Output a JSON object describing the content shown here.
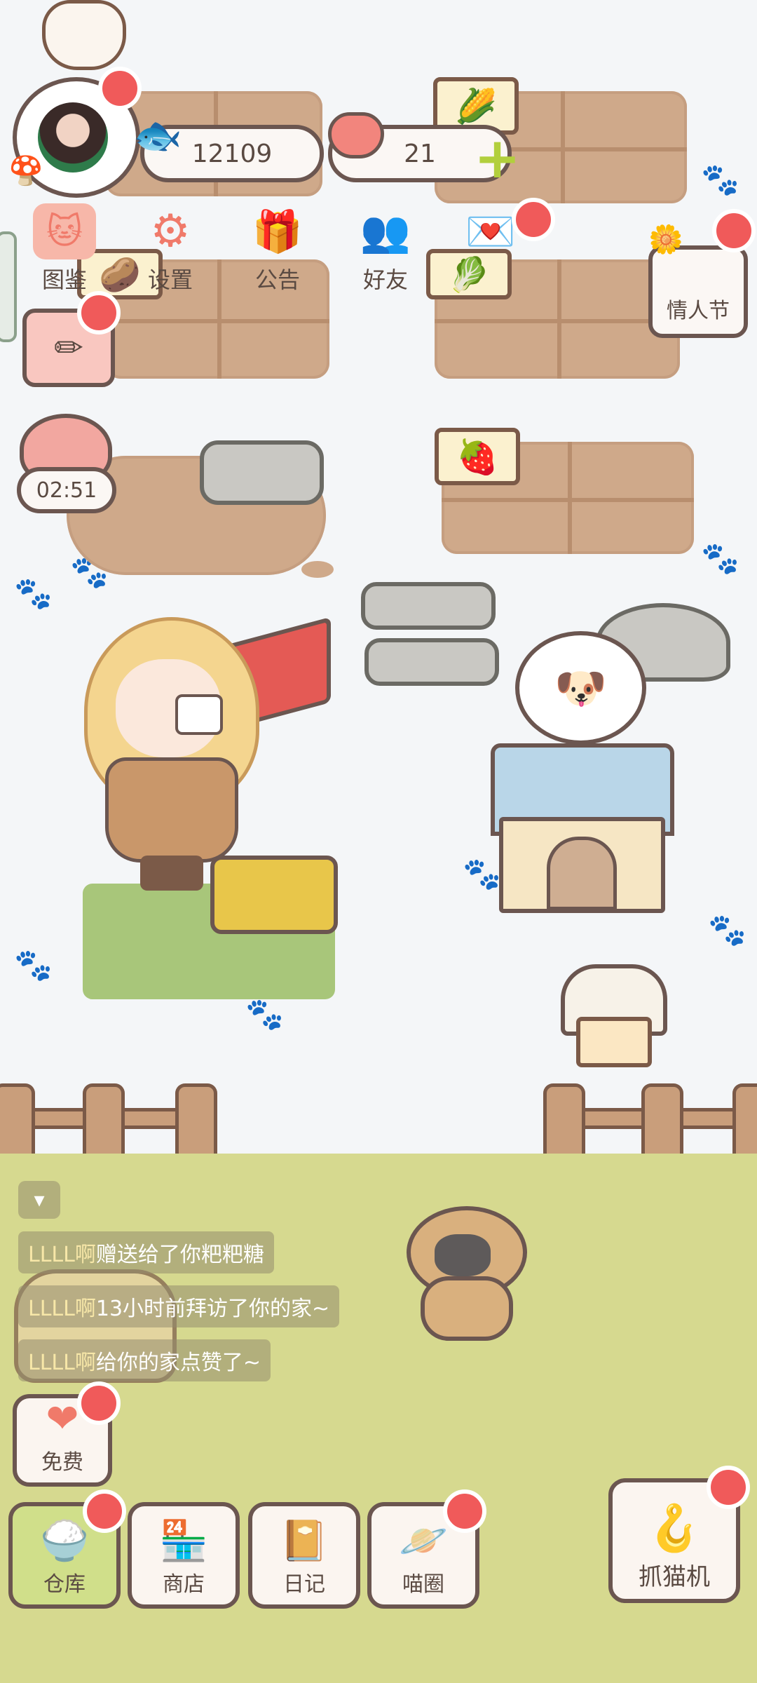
{
  "profile": {
    "avatar_alt": "player avatar"
  },
  "currency": {
    "coins": "12109",
    "hearts": "21"
  },
  "top_menu": [
    {
      "label": "图鉴",
      "icon": "cat-head-icon"
    },
    {
      "label": "设置",
      "icon": "gear-icon"
    },
    {
      "label": "公告",
      "icon": "gift-icon"
    },
    {
      "label": "好友",
      "icon": "friends-icon"
    },
    {
      "label": "",
      "icon": "heart-mail-icon"
    }
  ],
  "event": {
    "label": "情人节"
  },
  "timer": {
    "value": "02:51"
  },
  "chat": [
    {
      "name": "LLLL啊",
      "text": "赠送给了你粑粑糖"
    },
    {
      "name": "LLLL啊",
      "text": "13小时前拜访了你的家~"
    },
    {
      "name": "LLLL啊",
      "text": "给你的家点赞了~"
    }
  ],
  "free_button": {
    "label": "免费"
  },
  "bottom_bar": [
    {
      "label": "仓库",
      "icon": "warehouse-icon"
    },
    {
      "label": "商店",
      "icon": "shop-icon"
    },
    {
      "label": "日记",
      "icon": "diary-icon"
    },
    {
      "label": "喵圈",
      "icon": "cat-planet-icon"
    }
  ],
  "claw_machine": {
    "label": "抓猫机"
  },
  "colors": {
    "background": "#f4f6f8",
    "grass": "#d6d98f",
    "soil": "#cfa98a",
    "badge": "#f05a5a",
    "outline": "#6b5650"
  }
}
